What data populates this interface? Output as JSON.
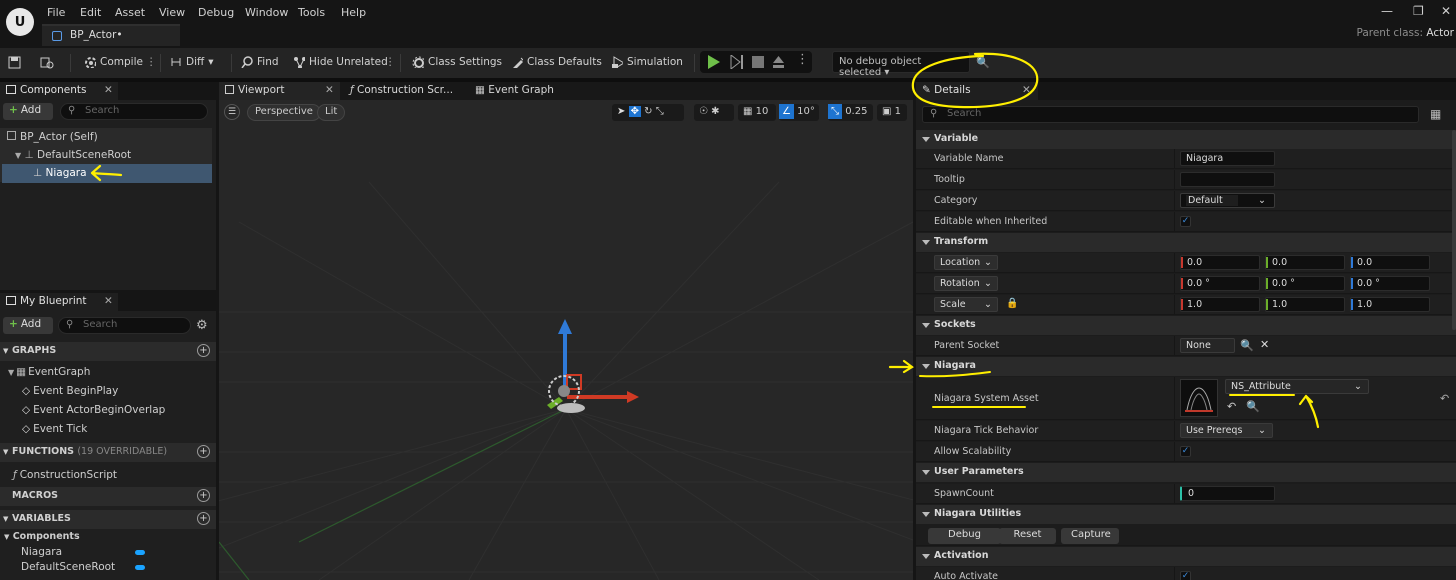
{
  "menubar": {
    "logo": "U",
    "items": [
      "File",
      "Edit",
      "Asset",
      "View",
      "Debug",
      "Window",
      "Tools",
      "Help"
    ],
    "doc_tab": "BP_Actor•",
    "parent_class_label": "Parent class:",
    "parent_class_value": "Actor"
  },
  "toolbar": {
    "compile": "Compile",
    "diff": "Diff",
    "find": "Find",
    "hide_unrelated": "Hide Unrelated",
    "class_settings": "Class Settings",
    "class_defaults": "Class Defaults",
    "simulation": "Simulation",
    "debug_object": "No debug object selected"
  },
  "components": {
    "tab": "Components",
    "add": "Add",
    "search_placeholder": "Search",
    "tree": [
      "BP_Actor (Self)",
      "DefaultSceneRoot",
      "Niagara"
    ]
  },
  "blueprint": {
    "tab": "My Blueprint",
    "add": "Add",
    "search_placeholder": "Search",
    "graphs_header": "GRAPHS",
    "event_graph": "EventGraph",
    "events": [
      "Event BeginPlay",
      "Event ActorBeginOverlap",
      "Event Tick"
    ],
    "functions_header": "FUNCTIONS",
    "functions_count": "(19 OVERRIDABLE)",
    "construction_script": "ConstructionScript",
    "macros_header": "MACROS",
    "variables_header": "VARIABLES",
    "components_group": "Components",
    "variables": [
      "Niagara",
      "DefaultSceneRoot"
    ]
  },
  "editor_tabs": {
    "viewport": "Viewport",
    "construction": "Construction Scr...",
    "event_graph": "Event Graph"
  },
  "viewport": {
    "perspective": "Perspective",
    "lit": "Lit",
    "grid_snap": "10",
    "rot_snap": "10°",
    "scale_snap": "0.25",
    "camera_speed": "1"
  },
  "details": {
    "tab": "Details",
    "search_placeholder": "Search",
    "variable": {
      "header": "Variable",
      "name_label": "Variable Name",
      "name_value": "Niagara",
      "tooltip_label": "Tooltip",
      "category_label": "Category",
      "category_value": "Default",
      "editable_label": "Editable when Inherited"
    },
    "transform": {
      "header": "Transform",
      "location": "Location",
      "rotation": "Rotation",
      "scale": "Scale",
      "loc": [
        "0.0",
        "0.0",
        "0.0"
      ],
      "rot": [
        "0.0 °",
        "0.0 °",
        "0.0 °"
      ],
      "scl": [
        "1.0",
        "1.0",
        "1.0"
      ]
    },
    "sockets": {
      "header": "Sockets",
      "parent_label": "Parent Socket",
      "parent_value": "None"
    },
    "niagara": {
      "header": "Niagara",
      "asset_label": "Niagara System Asset",
      "asset_value": "NS_Attribute",
      "tick_label": "Niagara Tick Behavior",
      "tick_value": "Use Prereqs",
      "scal_label": "Allow Scalability"
    },
    "user_params": {
      "header": "User Parameters",
      "spawn_label": "SpawnCount",
      "spawn_value": "0"
    },
    "utilities": {
      "header": "Niagara Utilities",
      "debug": "Debug",
      "reset": "Reset",
      "capture": "Capture"
    },
    "activation": {
      "header": "Activation",
      "auto_label": "Auto Activate"
    }
  },
  "colors": {
    "accent": "#1aa3ff",
    "annotation": "#ffef00",
    "play": "#6fc04a"
  }
}
